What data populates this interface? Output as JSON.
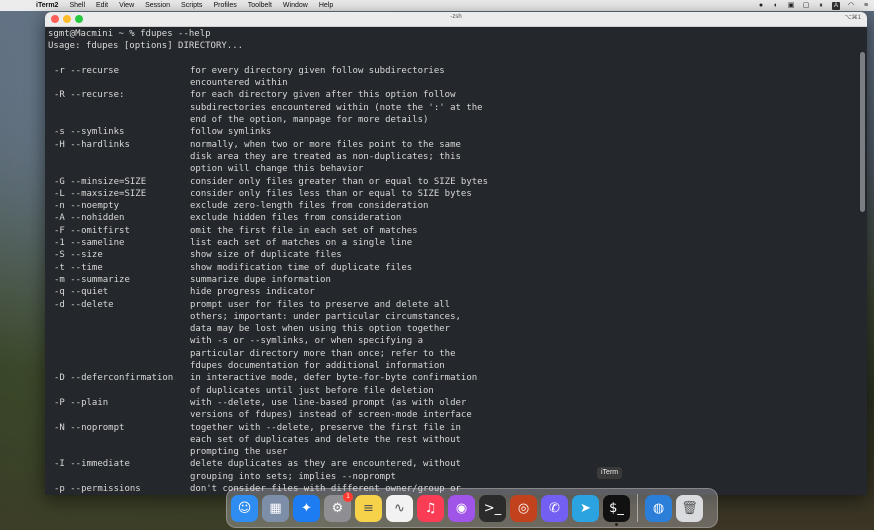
{
  "menubar": {
    "app_name": "iTerm2",
    "items": [
      "Shell",
      "Edit",
      "View",
      "Session",
      "Scripts",
      "Profiles",
      "Toolbelt",
      "Window",
      "Help"
    ],
    "status_icons": [
      "record-icon",
      "app-icon",
      "lock-icon",
      "display-icon",
      "pause-icon",
      "a-input-icon",
      "wifi-icon",
      "control-center-icon"
    ]
  },
  "window": {
    "title": "-zsh",
    "shortcut": "⌥⌘1"
  },
  "terminal": {
    "prompt": "sgmt@Macmini ~ % fdupes --help",
    "usage": "Usage: fdupes [options] DIRECTORY...",
    "options": [
      {
        "cmd": "-r --recurse",
        "desc": [
          "for every directory given follow subdirectories",
          "encountered within"
        ]
      },
      {
        "cmd": "-R --recurse:",
        "desc": [
          "for each directory given after this option follow",
          "subdirectories encountered within (note the ':' at the",
          "end of the option, manpage for more details)"
        ]
      },
      {
        "cmd": "-s --symlinks",
        "desc": [
          "follow symlinks"
        ]
      },
      {
        "cmd": "-H --hardlinks",
        "desc": [
          "normally, when two or more files point to the same",
          "disk area they are treated as non-duplicates; this",
          "option will change this behavior"
        ]
      },
      {
        "cmd": "-G --minsize=SIZE",
        "desc": [
          "consider only files greater than or equal to SIZE bytes"
        ]
      },
      {
        "cmd": "-L --maxsize=SIZE",
        "desc": [
          "consider only files less than or equal to SIZE bytes"
        ]
      },
      {
        "cmd": "-n --noempty",
        "desc": [
          "exclude zero-length files from consideration"
        ]
      },
      {
        "cmd": "-A --nohidden",
        "desc": [
          "exclude hidden files from consideration"
        ]
      },
      {
        "cmd": "-F --omitfirst",
        "desc": [
          "omit the first file in each set of matches"
        ]
      },
      {
        "cmd": "-1 --sameline",
        "desc": [
          "list each set of matches on a single line"
        ]
      },
      {
        "cmd": "-S --size",
        "desc": [
          "show size of duplicate files"
        ]
      },
      {
        "cmd": "-t --time",
        "desc": [
          "show modification time of duplicate files"
        ]
      },
      {
        "cmd": "-m --summarize",
        "desc": [
          "summarize dupe information"
        ]
      },
      {
        "cmd": "-q --quiet",
        "desc": [
          "hide progress indicator"
        ]
      },
      {
        "cmd": "-d --delete",
        "desc": [
          "prompt user for files to preserve and delete all",
          "others; important: under particular circumstances,",
          "data may be lost when using this option together",
          "with -s or --symlinks, or when specifying a",
          "particular directory more than once; refer to the",
          "fdupes documentation for additional information"
        ]
      },
      {
        "cmd": "-D --deferconfirmation",
        "desc": [
          "in interactive mode, defer byte-for-byte confirmation",
          "of duplicates until just before file deletion"
        ]
      },
      {
        "cmd": "-P --plain",
        "desc": [
          "with --delete, use line-based prompt (as with older",
          "versions of fdupes) instead of screen-mode interface"
        ]
      },
      {
        "cmd": "-N --noprompt",
        "desc": [
          "together with --delete, preserve the first file in",
          "each set of duplicates and delete the rest without",
          "prompting the user"
        ]
      },
      {
        "cmd": "-I --immediate",
        "desc": [
          "delete duplicates as they are encountered, without",
          "grouping into sets; implies --noprompt"
        ]
      },
      {
        "cmd": "-p --permissions",
        "desc": [
          "don't consider files with different owner/group or"
        ]
      }
    ]
  },
  "tooltip": "iTerm",
  "dock": {
    "items": [
      {
        "name": "finder-icon",
        "color": "#2f8cf0",
        "glyph": "☺"
      },
      {
        "name": "launchpad-icon",
        "color": "#7d8ea8",
        "glyph": "▦"
      },
      {
        "name": "safari-icon",
        "color": "#1e7cf2",
        "glyph": "✦"
      },
      {
        "name": "system-settings-icon",
        "color": "#8e8e93",
        "glyph": "⚙",
        "badge": "1"
      },
      {
        "name": "notes-icon",
        "color": "#f6d24a",
        "glyph": "≡"
      },
      {
        "name": "activity-monitor-icon",
        "color": "#f2f2f2",
        "glyph": "∿"
      },
      {
        "name": "music-icon",
        "color": "#fa3c55",
        "glyph": "♫"
      },
      {
        "name": "podcasts-icon",
        "color": "#a054e8",
        "glyph": "◉"
      },
      {
        "name": "terminal-icon",
        "color": "#2b2b2b",
        "glyph": ">_"
      },
      {
        "name": "screenflow-icon",
        "color": "#c2421e",
        "glyph": "◎"
      },
      {
        "name": "viber-icon",
        "color": "#7360f2",
        "glyph": "✆"
      },
      {
        "name": "telegram-icon",
        "color": "#2aa3e0",
        "glyph": "➤"
      },
      {
        "name": "iterm-icon",
        "color": "#111111",
        "glyph": "$_",
        "running": true
      }
    ],
    "right_items": [
      {
        "name": "downloads-globe-icon",
        "color": "#2b7fd8",
        "glyph": "◍"
      },
      {
        "name": "trash-icon",
        "color": "#d9dbde",
        "glyph": "🗑"
      }
    ]
  }
}
